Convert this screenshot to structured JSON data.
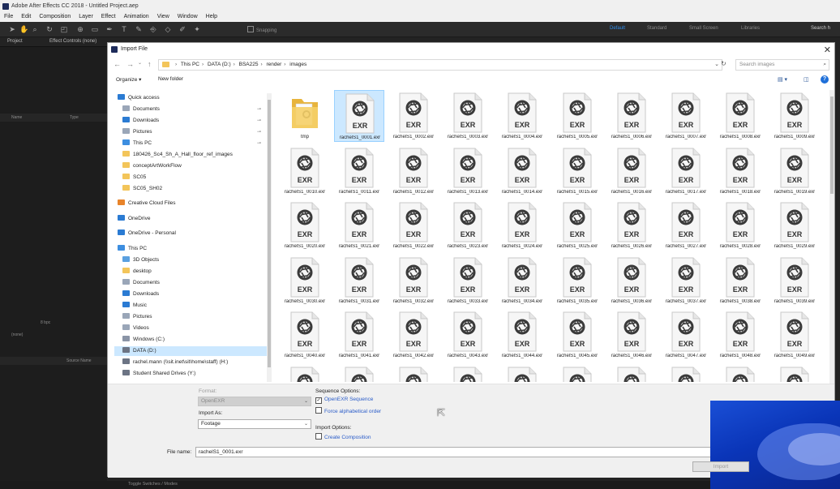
{
  "app": {
    "title": "Adobe After Effects CC 2018 - Untitled Project.aep",
    "menu": [
      "File",
      "Edit",
      "Composition",
      "Layer",
      "Effect",
      "Animation",
      "View",
      "Window",
      "Help"
    ],
    "snapping_label": "Snapping",
    "workspaces": [
      "Default",
      "Standard",
      "Small Screen",
      "Libraries"
    ],
    "search_help": "Search h",
    "panel_tabs": {
      "project": "Project",
      "effect_controls": "Effect Controls (none)"
    },
    "project_columns": {
      "name": "Name",
      "type": "Type"
    },
    "bpc": "8 bpc",
    "none_label": "(none)",
    "source_name": "Source Name",
    "toggle_label": "Toggle Switches / Modes"
  },
  "dialog": {
    "title": "Import File",
    "close": "✕",
    "breadcrumb": [
      "This PC",
      "DATA (D:)",
      "BSA225",
      "render",
      "images"
    ],
    "search_placeholder": "Search images",
    "organize": "Organize ▾",
    "new_folder": "New folder",
    "nav_pane": [
      {
        "label": "Quick access",
        "icon": "star-icon",
        "color": "#2b7bd3",
        "indent": 0,
        "pinned": false
      },
      {
        "label": "Documents",
        "icon": "documents-icon",
        "color": "#9aa6b8",
        "indent": 1,
        "pinned": true
      },
      {
        "label": "Downloads",
        "icon": "downloads-icon",
        "color": "#2b7bd3",
        "indent": 1,
        "pinned": true
      },
      {
        "label": "Pictures",
        "icon": "pictures-icon",
        "color": "#9aa6b8",
        "indent": 1,
        "pinned": true
      },
      {
        "label": "This PC",
        "icon": "computer-icon",
        "color": "#3d8ee0",
        "indent": 1,
        "pinned": true
      },
      {
        "label": "180426_Sc4_Sh_A_Hall_floor_ref_images",
        "icon": "folder-icon",
        "color": "#f3c55a",
        "indent": 1,
        "pinned": false
      },
      {
        "label": "conceptArtWorkFlow",
        "icon": "folder-icon",
        "color": "#f3c55a",
        "indent": 1,
        "pinned": false
      },
      {
        "label": "SC05",
        "icon": "folder-icon",
        "color": "#f3c55a",
        "indent": 1,
        "pinned": false
      },
      {
        "label": "SC05_SH02",
        "icon": "folder-icon",
        "color": "#f3c55a",
        "indent": 1,
        "pinned": false
      },
      {
        "label": "Creative Cloud Files",
        "icon": "creative-cloud-icon",
        "color": "#e8842a",
        "indent": 0,
        "pinned": false
      },
      {
        "label": "OneDrive",
        "icon": "onedrive-icon",
        "color": "#2b7bd3",
        "indent": 0,
        "pinned": false
      },
      {
        "label": "OneDrive - Personal",
        "icon": "onedrive-icon",
        "color": "#2b7bd3",
        "indent": 0,
        "pinned": false
      },
      {
        "label": "This PC",
        "icon": "computer-icon",
        "color": "#3d8ee0",
        "indent": 0,
        "pinned": false
      },
      {
        "label": "3D Objects",
        "icon": "objects3d-icon",
        "color": "#5aa0e0",
        "indent": 1,
        "pinned": false
      },
      {
        "label": "desktop",
        "icon": "folder-icon",
        "color": "#f3c55a",
        "indent": 1,
        "pinned": false
      },
      {
        "label": "Documents",
        "icon": "documents-icon",
        "color": "#9aa6b8",
        "indent": 1,
        "pinned": false
      },
      {
        "label": "Downloads",
        "icon": "downloads-icon",
        "color": "#2b7bd3",
        "indent": 1,
        "pinned": false
      },
      {
        "label": "Music",
        "icon": "music-icon",
        "color": "#2b7bd3",
        "indent": 1,
        "pinned": false
      },
      {
        "label": "Pictures",
        "icon": "pictures-icon",
        "color": "#9aa6b8",
        "indent": 1,
        "pinned": false
      },
      {
        "label": "Videos",
        "icon": "videos-icon",
        "color": "#9aa6b8",
        "indent": 1,
        "pinned": false
      },
      {
        "label": "Windows (C:)",
        "icon": "drive-icon",
        "color": "#8a94a6",
        "indent": 1,
        "pinned": false
      },
      {
        "label": "DATA (D:)",
        "icon": "drive-icon",
        "color": "#6c7484",
        "indent": 1,
        "pinned": false,
        "selected": true
      },
      {
        "label": "rachel.mann (\\\\sit.inet\\sit\\home\\staff) (H:)",
        "icon": "network-drive-icon",
        "color": "#6c7484",
        "indent": 1,
        "pinned": false
      },
      {
        "label": "Student Shared Drives (Y:)",
        "icon": "network-drive-icon",
        "color": "#6c7484",
        "indent": 1,
        "pinned": false
      }
    ],
    "files": [
      {
        "name": "tmp",
        "kind": "folder"
      },
      {
        "name": "rachelS1_0001.exr",
        "kind": "exr",
        "selected": true
      },
      {
        "name": "rachelS1_0002.exr",
        "kind": "exr"
      },
      {
        "name": "rachelS1_0003.exr",
        "kind": "exr"
      },
      {
        "name": "rachelS1_0004.exr",
        "kind": "exr"
      },
      {
        "name": "rachelS1_0005.exr",
        "kind": "exr"
      },
      {
        "name": "rachelS1_0006.exr",
        "kind": "exr"
      },
      {
        "name": "rachelS1_0007.exr",
        "kind": "exr"
      },
      {
        "name": "rachelS1_0008.exr",
        "kind": "exr"
      },
      {
        "name": "rachelS1_0009.exr",
        "kind": "exr"
      },
      {
        "name": "rachelS1_0010.exr",
        "kind": "exr"
      },
      {
        "name": "rachelS1_0011.exr",
        "kind": "exr"
      },
      {
        "name": "rachelS1_0012.exr",
        "kind": "exr"
      },
      {
        "name": "rachelS1_0013.exr",
        "kind": "exr"
      },
      {
        "name": "rachelS1_0014.exr",
        "kind": "exr"
      },
      {
        "name": "rachelS1_0015.exr",
        "kind": "exr"
      },
      {
        "name": "rachelS1_0016.exr",
        "kind": "exr"
      },
      {
        "name": "rachelS1_0017.exr",
        "kind": "exr"
      },
      {
        "name": "rachelS1_0018.exr",
        "kind": "exr"
      },
      {
        "name": "rachelS1_0019.exr",
        "kind": "exr"
      },
      {
        "name": "rachelS1_0020.exr",
        "kind": "exr"
      },
      {
        "name": "rachelS1_0021.exr",
        "kind": "exr"
      },
      {
        "name": "rachelS1_0022.exr",
        "kind": "exr"
      },
      {
        "name": "rachelS1_0023.exr",
        "kind": "exr"
      },
      {
        "name": "rachelS1_0024.exr",
        "kind": "exr"
      },
      {
        "name": "rachelS1_0025.exr",
        "kind": "exr"
      },
      {
        "name": "rachelS1_0026.exr",
        "kind": "exr"
      },
      {
        "name": "rachelS1_0027.exr",
        "kind": "exr"
      },
      {
        "name": "rachelS1_0028.exr",
        "kind": "exr"
      },
      {
        "name": "rachelS1_0029.exr",
        "kind": "exr"
      },
      {
        "name": "rachelS1_0030.exr",
        "kind": "exr"
      },
      {
        "name": "rachelS1_0031.exr",
        "kind": "exr"
      },
      {
        "name": "rachelS1_0032.exr",
        "kind": "exr"
      },
      {
        "name": "rachelS1_0033.exr",
        "kind": "exr"
      },
      {
        "name": "rachelS1_0034.exr",
        "kind": "exr"
      },
      {
        "name": "rachelS1_0035.exr",
        "kind": "exr"
      },
      {
        "name": "rachelS1_0036.exr",
        "kind": "exr"
      },
      {
        "name": "rachelS1_0037.exr",
        "kind": "exr"
      },
      {
        "name": "rachelS1_0038.exr",
        "kind": "exr"
      },
      {
        "name": "rachelS1_0039.exr",
        "kind": "exr"
      },
      {
        "name": "rachelS1_0040.exr",
        "kind": "exr"
      },
      {
        "name": "rachelS1_0041.exr",
        "kind": "exr"
      },
      {
        "name": "rachelS1_0042.exr",
        "kind": "exr"
      },
      {
        "name": "rachelS1_0043.exr",
        "kind": "exr"
      },
      {
        "name": "rachelS1_0044.exr",
        "kind": "exr"
      },
      {
        "name": "rachelS1_0045.exr",
        "kind": "exr"
      },
      {
        "name": "rachelS1_0046.exr",
        "kind": "exr"
      },
      {
        "name": "rachelS1_0047.exr",
        "kind": "exr"
      },
      {
        "name": "rachelS1_0048.exr",
        "kind": "exr"
      },
      {
        "name": "rachelS1_0049.exr",
        "kind": "exr"
      }
    ],
    "exr_label": "EXR",
    "options": {
      "format_label": "Format:",
      "format_value": "OpenEXR",
      "import_as_label": "Import As:",
      "import_as_value": "Footage",
      "sequence_options_label": "Sequence Options:",
      "openexr_sequence": "OpenEXR Sequence",
      "force_alpha": "Force alphabetical order",
      "import_options_label": "Import Options:",
      "create_composition": "Create Composition",
      "file_name_label": "File name:",
      "file_name_value": "rachelS1_0001.exr",
      "import_button": "Import"
    }
  }
}
